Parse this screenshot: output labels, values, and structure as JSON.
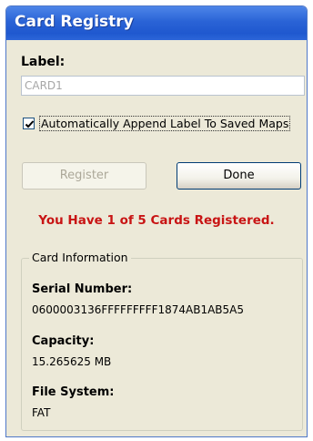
{
  "window": {
    "title": "Card Registry"
  },
  "label_field": {
    "heading": "Label:",
    "value": "CARD1"
  },
  "append_option": {
    "label": "Automatically Append Label To Saved Maps",
    "checked": true
  },
  "buttons": {
    "register": "Register",
    "done": "Done"
  },
  "status_message": "You Have 1 of 5 Cards Registered.",
  "card_info": {
    "group_title": "Card Information",
    "serial_label": "Serial Number:",
    "serial_value": "0600003136FFFFFFFFF1874AB1AB5A5",
    "capacity_label": "Capacity:",
    "capacity_value": "15.265625 MB",
    "filesystem_label": "File System:",
    "filesystem_value": "FAT"
  },
  "colors": {
    "titlebar": "#2a63d6",
    "status_text": "#c81414",
    "dialog_background": "#ece9d8"
  }
}
